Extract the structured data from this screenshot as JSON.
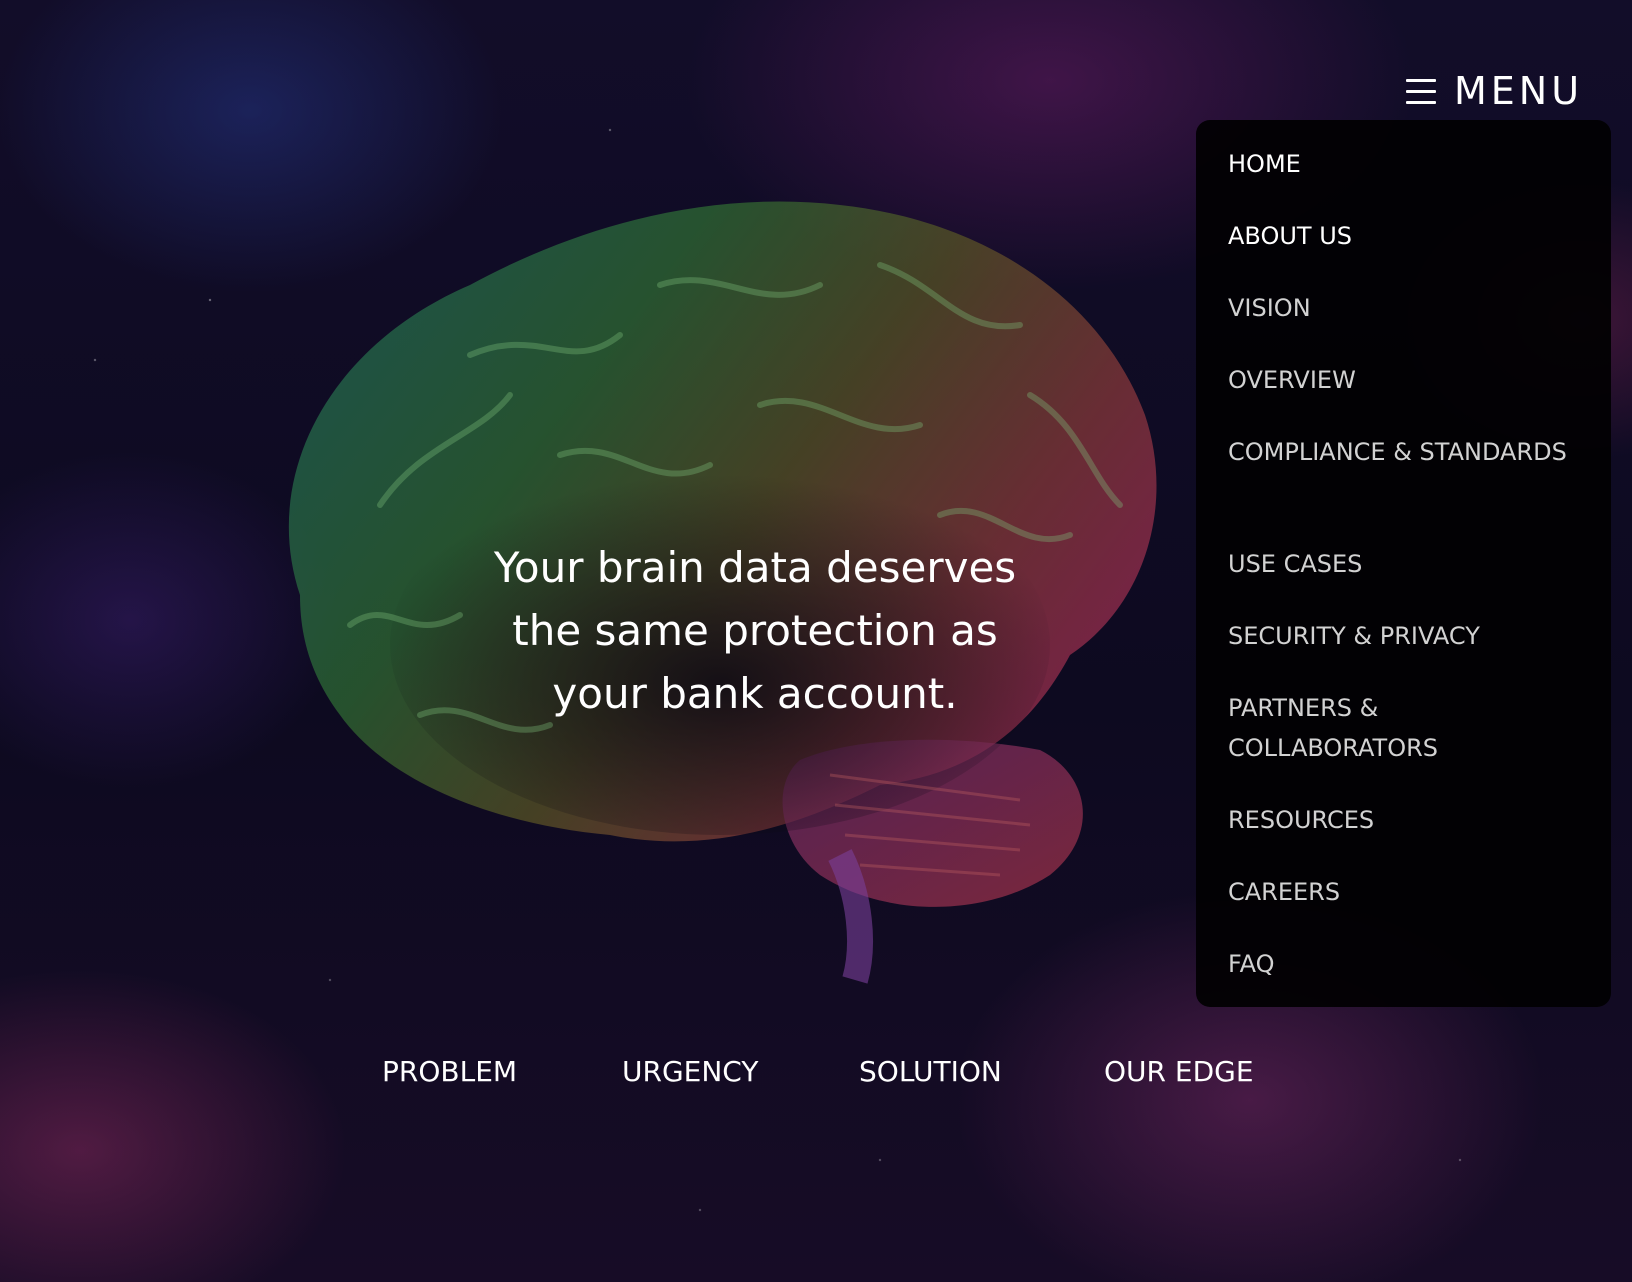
{
  "header": {
    "menu_label": "MENU",
    "menu_icon": "hamburger-icon"
  },
  "menu": {
    "items": [
      {
        "label": "HOME"
      },
      {
        "label": "ABOUT US"
      },
      {
        "label": "VISION"
      },
      {
        "label": "OVERVIEW"
      },
      {
        "label": "COMPLIANCE & STANDARDS"
      },
      {
        "label": "USE CASES"
      },
      {
        "label": "SECURITY & PRIVACY"
      },
      {
        "label": "PARTNERS & COLLABORATORS"
      },
      {
        "label": "RESOURCES"
      },
      {
        "label": "CAREERS"
      },
      {
        "label": "FAQ"
      }
    ]
  },
  "hero": {
    "line1": "Your brain data deserves",
    "line2": "the same protection as",
    "line3": "your bank account.",
    "background_icon": "brain-icon"
  },
  "sections": {
    "items": [
      {
        "label": "PROBLEM"
      },
      {
        "label": "URGENCY"
      },
      {
        "label": "SOLUTION"
      },
      {
        "label": "OUR EDGE"
      }
    ]
  },
  "colors": {
    "background": "#0c0a1c",
    "menu_panel": "#020103",
    "text": "#ffffff",
    "menu_text": "#d2d2d2"
  }
}
